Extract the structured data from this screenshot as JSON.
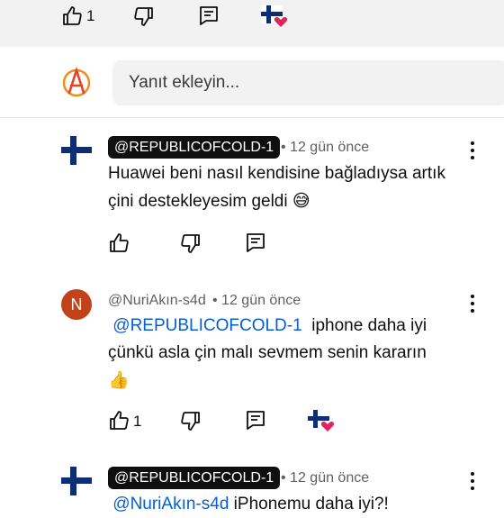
{
  "top_actions": {
    "like_count": "1"
  },
  "reply": {
    "placeholder": "Yanıt ekleyin..."
  },
  "comments": [
    {
      "author": "@REPUBLICOFCOLD-1",
      "time": "• 12 gün önce",
      "text_line1": "Huawei beni nasıl kendisine bağladıysa artık",
      "text_line2": "çini destekleyesim geldi",
      "emoji": "😅",
      "like_count": ""
    },
    {
      "author": "@NuriAkın-s4d",
      "avatar_letter": "N",
      "time": "• 12 gün önce",
      "mention": "@REPUBLICOFCOLD-1",
      "text_line1_rest": "iphone daha iyi",
      "text_line2": "çünkü asla çin malı sevmem senin kararın",
      "emoji": "👍",
      "like_count": "1"
    },
    {
      "author": "@REPUBLICOFCOLD-1",
      "time": "• 12 gün önce",
      "mention": "@NuriAkın-s4d",
      "text_line1_rest": "iPhonemu daha iyi?!"
    }
  ],
  "colors": {
    "accent_link": "#065fd4",
    "chip_bg": "#0f0f0f",
    "heart": "#e0245e",
    "flag_blue": "#0d2e74"
  }
}
